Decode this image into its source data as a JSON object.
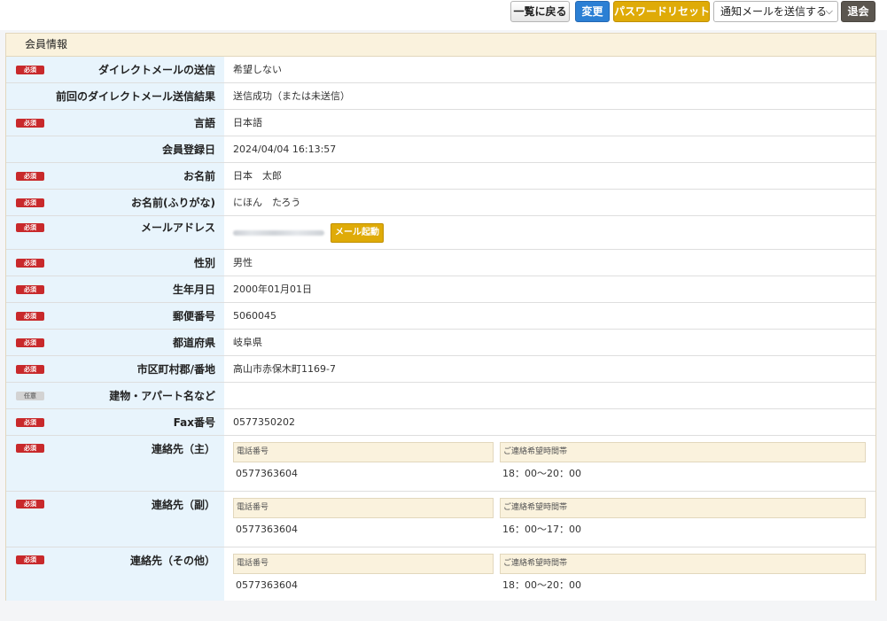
{
  "toolbar": {
    "back_label": "一覧に戻る",
    "change_label": "変更",
    "password_reset_label": "パスワードリセット",
    "notify_select_value": "通知メールを送信する",
    "withdraw_label": "退会"
  },
  "panel": {
    "title": "会員情報"
  },
  "badges": {
    "required": "必須",
    "optional": "任意"
  },
  "rows": [
    {
      "label": "ダイレクトメールの送信",
      "value": "希望しない"
    },
    {
      "label": "前回のダイレクトメール送信結果",
      "value": "送信成功（または未送信）"
    },
    {
      "label": "言語",
      "value": "日本語"
    },
    {
      "label": "会員登録日",
      "value": "2024/04/04 16:13:57"
    },
    {
      "label": "お名前",
      "value": "日本　太郎"
    },
    {
      "label": "お名前(ふりがな)",
      "value": "にほん　たろう"
    },
    {
      "label": "メールアドレス",
      "button": "メール起動"
    },
    {
      "label": "性別",
      "value": "男性"
    },
    {
      "label": "生年月日",
      "value": "2000年01月01日"
    },
    {
      "label": "郵便番号",
      "value": "5060045"
    },
    {
      "label": "都道府県",
      "value": "岐阜県"
    },
    {
      "label": "市区町村郡/番地",
      "value": "高山市赤保木町1169-7"
    },
    {
      "label": "建物・アパート名など",
      "value": ""
    },
    {
      "label": "Fax番号",
      "value": "0577350202"
    }
  ],
  "contacts": {
    "phone_header": "電話番号",
    "time_header": "ご連絡希望時間帯",
    "items": [
      {
        "label": "連絡先（主）",
        "phone": "0577363604",
        "time": "18：00〜20：00"
      },
      {
        "label": "連絡先（副）",
        "phone": "0577363604",
        "time": "16：00〜17：00"
      },
      {
        "label": "連絡先（その他）",
        "phone": "0577363604",
        "time": "18：00〜20：00"
      }
    ]
  }
}
